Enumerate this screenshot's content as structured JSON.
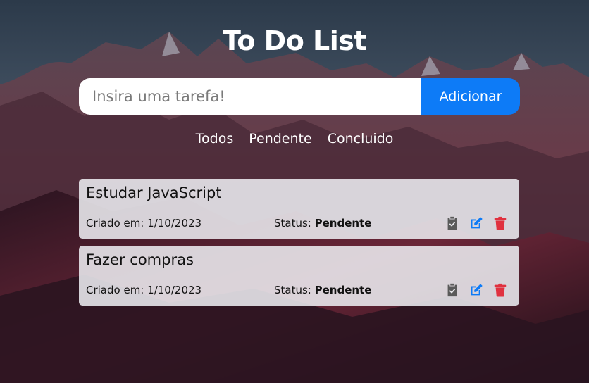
{
  "app": {
    "title": "To Do List"
  },
  "form": {
    "placeholder": "Insira uma tarefa!",
    "add_label": "Adicionar"
  },
  "filters": [
    "Todos",
    "Pendente",
    "Concluido"
  ],
  "tasks": [
    {
      "title": "Estudar JavaScript",
      "created_label": "Criado em:",
      "created_date": "1/10/2023",
      "status_label": "Status:",
      "status_value": "Pendente"
    },
    {
      "title": "Fazer compras",
      "created_label": "Criado em:",
      "created_date": "1/10/2023",
      "status_label": "Status:",
      "status_value": "Pendente"
    }
  ],
  "icons": {
    "complete": "clipboard-check-icon",
    "edit": "edit-icon",
    "delete": "trash-icon"
  },
  "colors": {
    "accent": "#0d7bf7",
    "delete": "#e0313f",
    "complete": "#5a5a5a",
    "edit": "#0d7bf7"
  }
}
